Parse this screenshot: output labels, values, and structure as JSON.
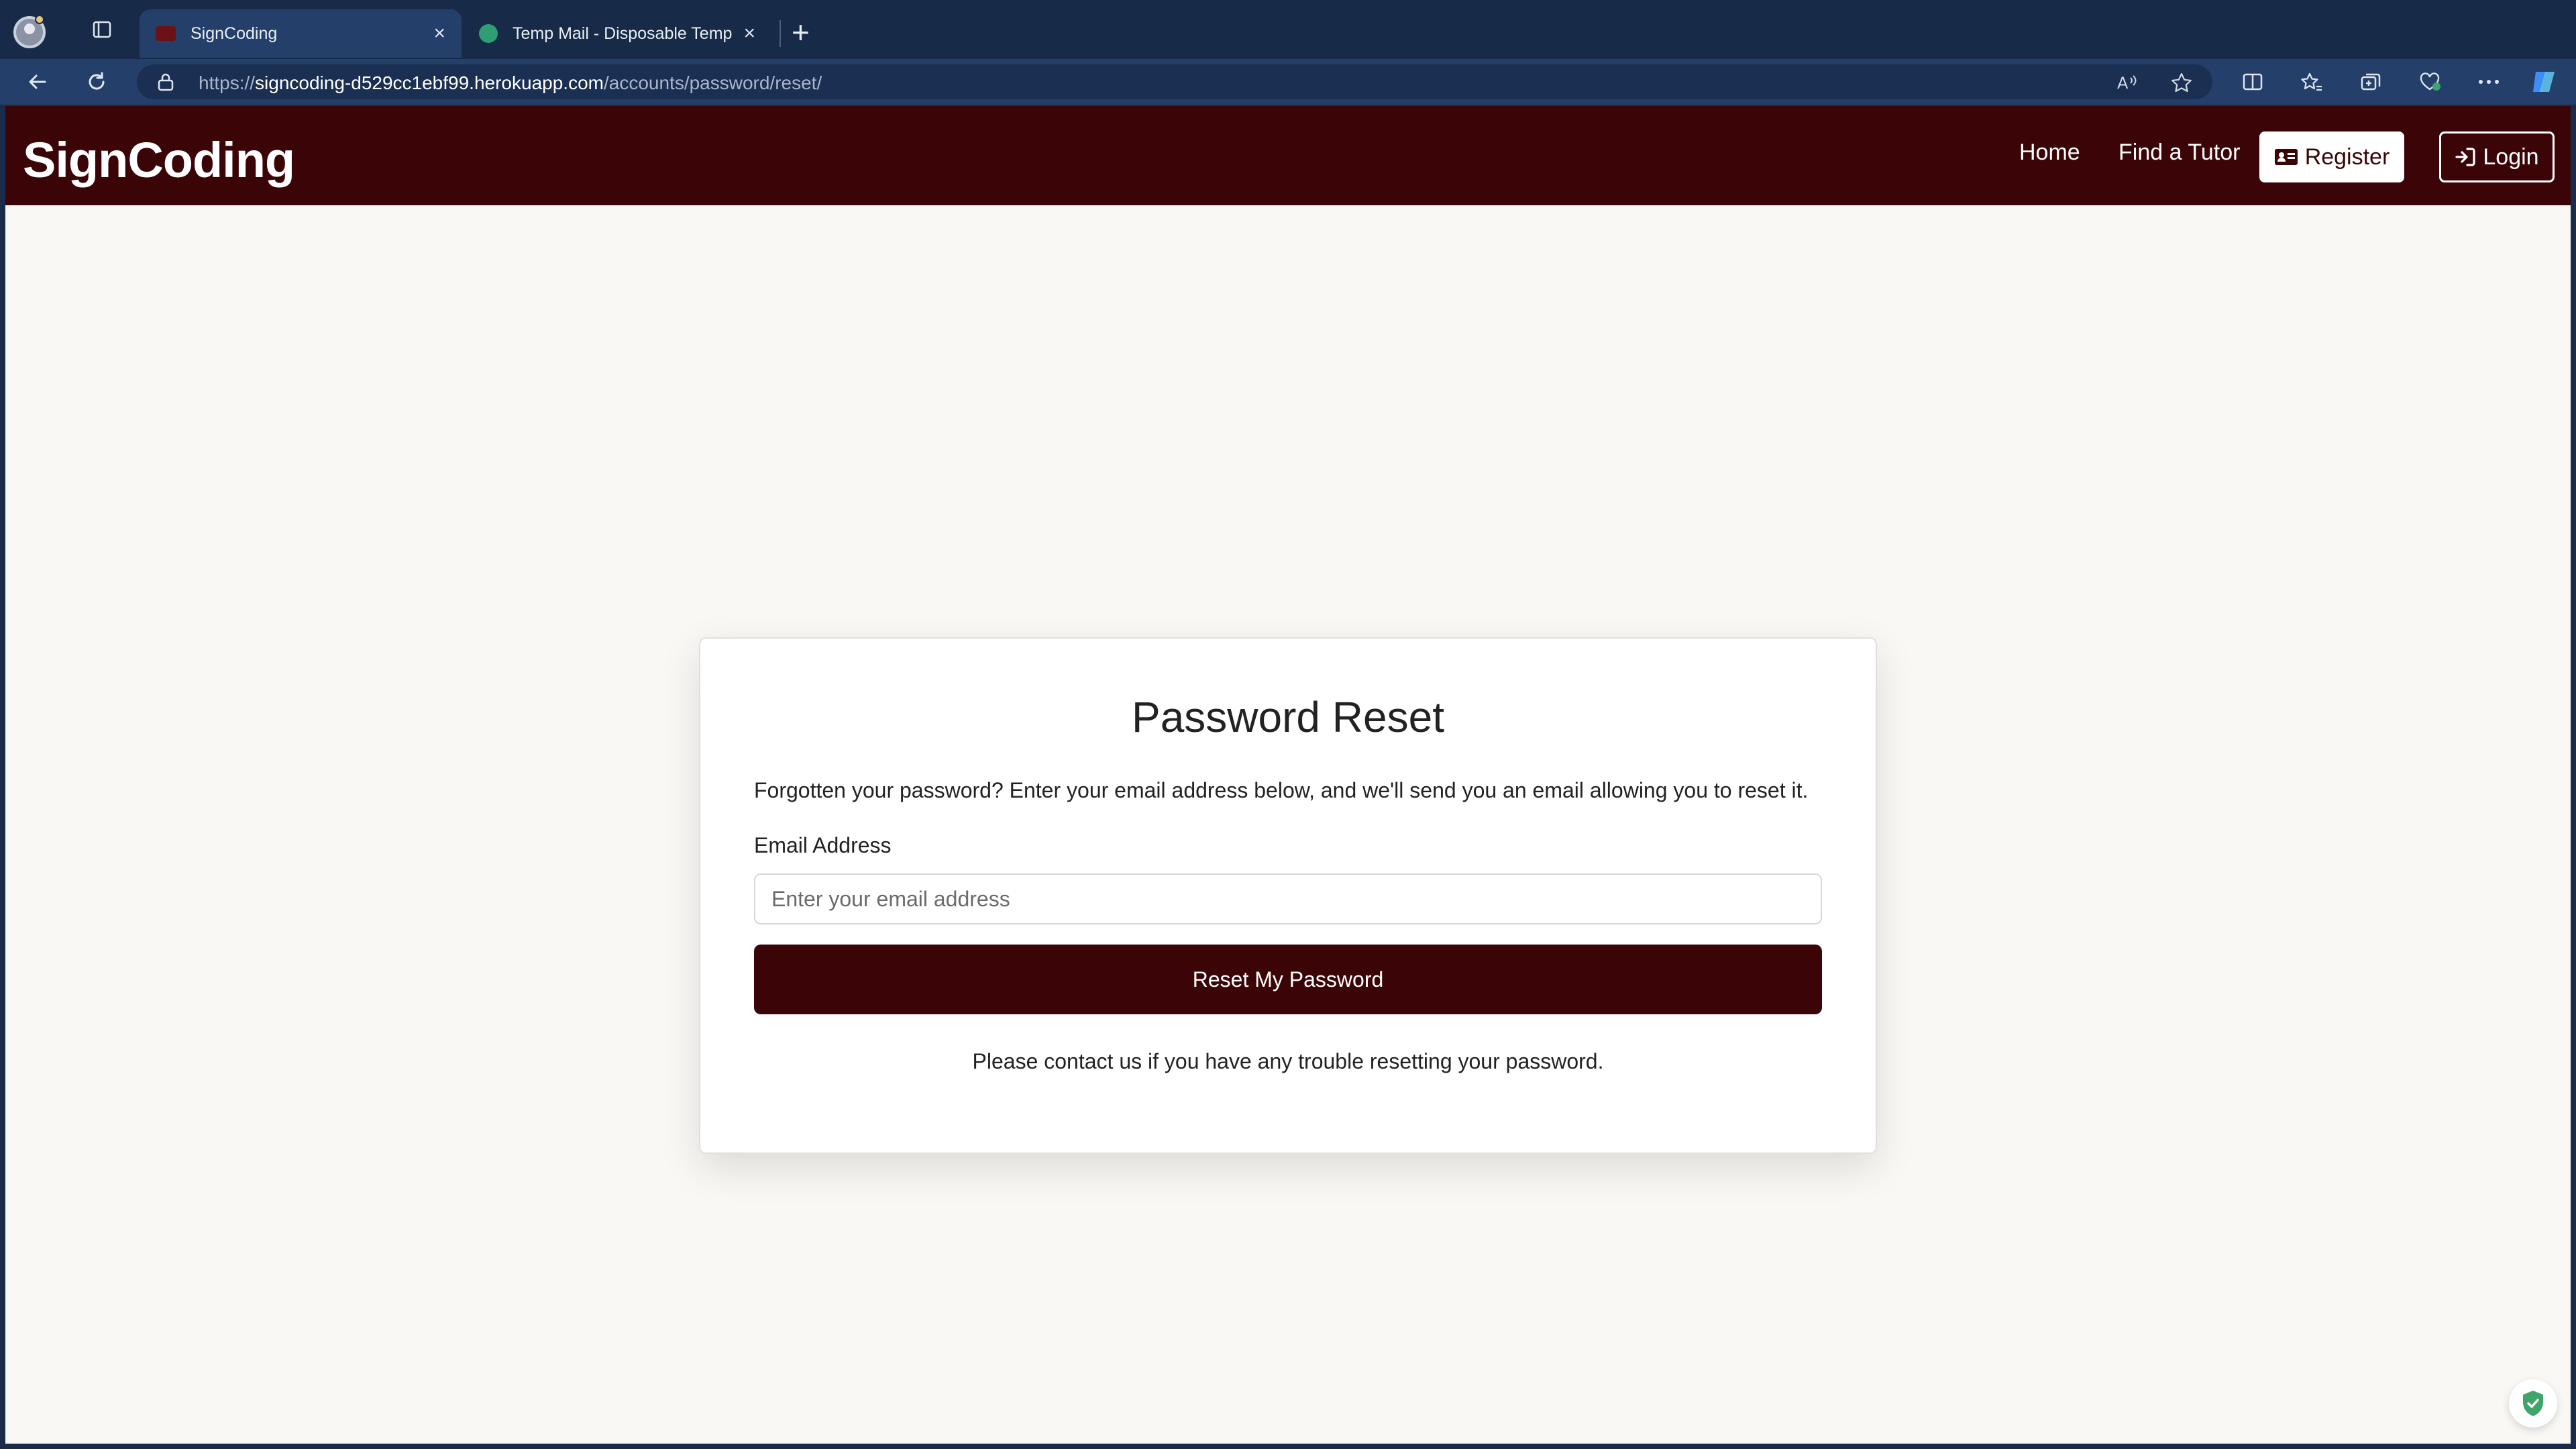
{
  "browser": {
    "tabs": [
      {
        "title": "SignCoding",
        "favicon_color": "#6b1216",
        "active": true
      },
      {
        "title": "Temp Mail - Disposable Tempor",
        "favicon_color": "#2f9e74",
        "active": false
      }
    ],
    "url": {
      "scheme": "https://",
      "host": "signcoding-d529cc1ebf99.herokuapp.com",
      "path": "/accounts/password/reset/"
    }
  },
  "site": {
    "brand": "SignCoding",
    "nav": {
      "home": "Home",
      "find_tutor": "Find a Tutor",
      "register": "Register",
      "login": "Login"
    }
  },
  "card": {
    "title": "Password Reset",
    "intro": "Forgotten your password? Enter your email address below, and we'll send you an email allowing you to reset it.",
    "email_label": "Email Address",
    "email_placeholder": "Enter your email address",
    "email_value": "",
    "submit_label": "Reset My Password",
    "footer": "Please contact us if you have any trouble resetting your password."
  },
  "colors": {
    "brand": "#3b0508",
    "page_bg": "#faf8f4",
    "chrome_bg": "#172a48"
  }
}
